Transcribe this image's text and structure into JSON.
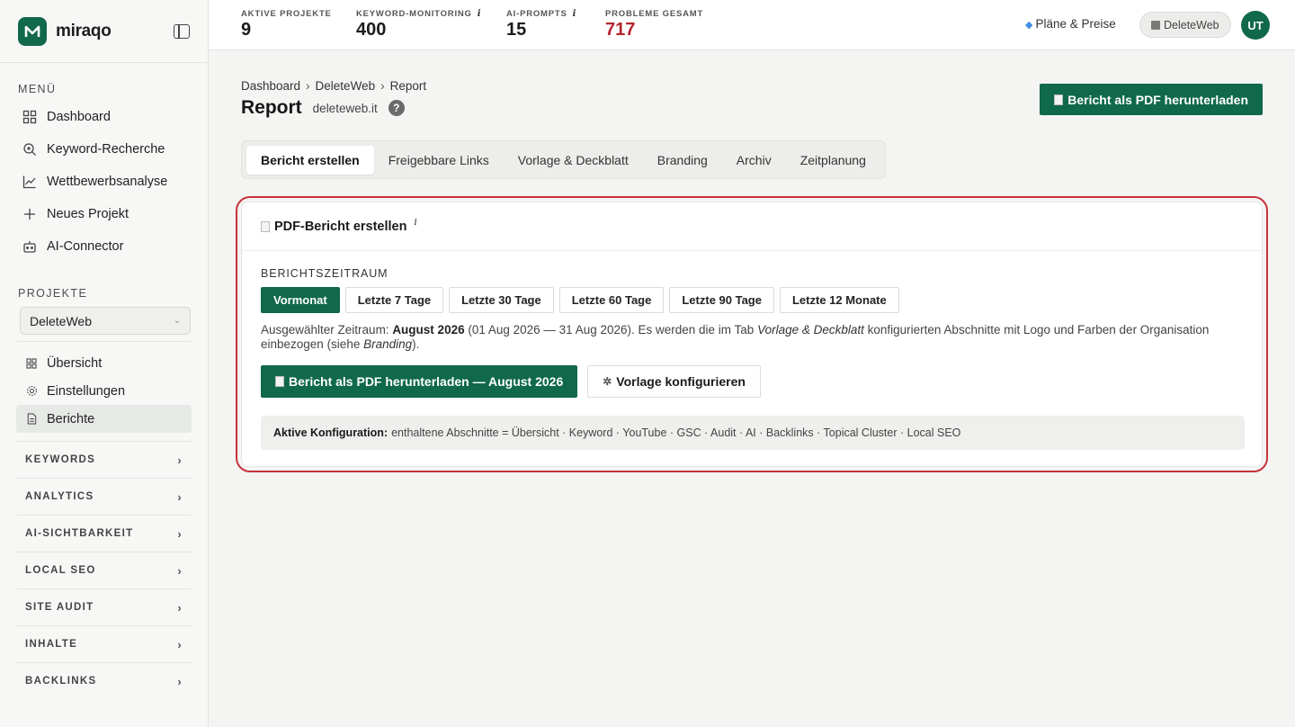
{
  "brand": {
    "name": "miraqo"
  },
  "sidebar": {
    "menu_label": "MENÜ",
    "menu_items": [
      {
        "label": "Dashboard",
        "icon": "grid-icon"
      },
      {
        "label": "Keyword-Recherche",
        "icon": "search-icon"
      },
      {
        "label": "Wettbewerbsanalyse",
        "icon": "line-chart-icon"
      },
      {
        "label": "Neues Projekt",
        "icon": "plus-icon"
      },
      {
        "label": "AI-Connector",
        "icon": "robot-icon"
      }
    ],
    "projects_label": "PROJEKTE",
    "project_selected": "DeleteWeb",
    "project_items": [
      {
        "label": "Übersicht",
        "icon": "grid-icon"
      },
      {
        "label": "Einstellungen",
        "icon": "gear-icon"
      },
      {
        "label": "Berichte",
        "icon": "document-icon",
        "active": true
      }
    ],
    "groups": [
      "KEYWORDS",
      "ANALYTICS",
      "AI-SICHTBARKEIT",
      "LOCAL SEO",
      "SITE AUDIT",
      "INHALTE",
      "BACKLINKS"
    ]
  },
  "topbar": {
    "stats": [
      {
        "label": "AKTIVE PROJEKTE",
        "value": "9",
        "info": ""
      },
      {
        "label": "KEYWORD-MONITORING",
        "value": "400",
        "info": "i"
      },
      {
        "label": "AI-PROMPTS",
        "value": "15",
        "info": "i"
      },
      {
        "label": "PROBLEME GESAMT",
        "value": "717",
        "info": ""
      }
    ],
    "plans_label": "Pläne & Preise",
    "workspace_label": "DeleteWeb",
    "avatar_initials": "UT"
  },
  "page": {
    "breadcrumb": [
      "Dashboard",
      "DeleteWeb",
      "Report"
    ],
    "breadcrumb_sep": "›",
    "title": "Report",
    "domain": "deleteweb.it",
    "help": "?",
    "download_button": "Bericht als PDF herunterladen",
    "tabs": [
      "Bericht erstellen",
      "Freigebbare Links",
      "Vorlage & Deckblatt",
      "Branding",
      "Archiv",
      "Zeitplanung"
    ],
    "active_tab": 0
  },
  "card": {
    "title": "PDF-Bericht erstellen",
    "title_info": "i",
    "range_label": "BERICHTSZEITRAUM",
    "periods": [
      "Vormonat",
      "Letzte 7 Tage",
      "Letzte 30 Tage",
      "Letzte 60 Tage",
      "Letzte 90 Tage",
      "Letzte 12 Monate"
    ],
    "active_period": 0,
    "desc": {
      "prefix": "Ausgewählter Zeitraum: ",
      "period": "August 2026",
      "range": " (01 Aug 2026 — 31 Aug 2026). Es werden die im Tab ",
      "tab_ref": "Vorlage & Deckblatt",
      "middle": " konfigurierten Abschnitte mit Logo und Farben der Organisation einbezogen (siehe ",
      "branding_ref": "Branding",
      "suffix": ")."
    },
    "primary_button": "Bericht als PDF herunterladen — August 2026",
    "secondary_button": "Vorlage konfigurieren",
    "config_label": "Aktive Konfiguration:",
    "config_value": "enthaltene Abschnitte = Übersicht · Keyword · YouTube · GSC · Audit · AI · Backlinks · Topical Cluster · Local SEO"
  },
  "colors": {
    "primary": "#10694a",
    "danger": "#b3262f",
    "highlight": "#c8323a"
  }
}
